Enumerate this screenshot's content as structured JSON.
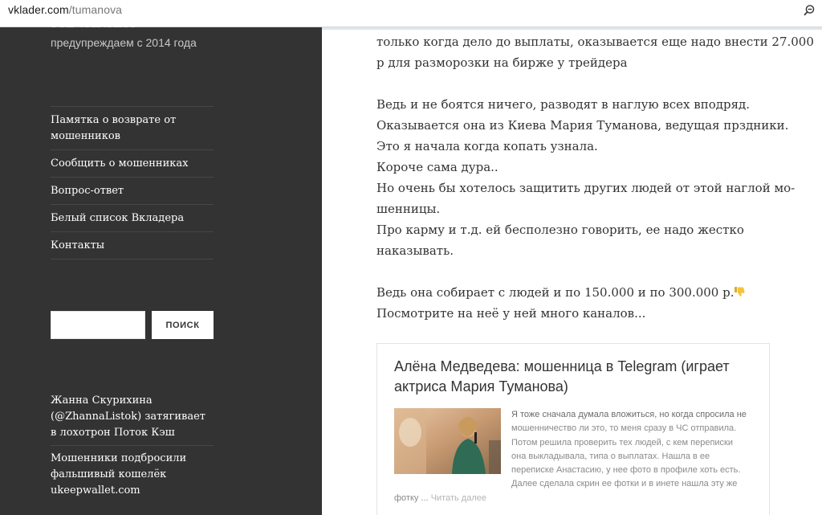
{
  "browser": {
    "domain": "vklader.com",
    "path": "/tumanova",
    "zoom_icon": "zoom-out-icon"
  },
  "sidebar": {
    "site_title": "Вкладер",
    "tagline": "предупреждаем с 2014 года",
    "menu": [
      "Памятка о возврате от мошенников",
      "Сообщить о мошенниках",
      "Вопрос-ответ",
      "Белый список Вкладера",
      "Контакты"
    ],
    "search": {
      "placeholder": "",
      "button_label": "ПОИСК"
    },
    "recent_posts": [
      "Жанна Скурихина (@ZhannaListok) затягивает в лохотрон Поток Кэш",
      "Мошенники подбросили фальшивый кошелёк ukeepwallet.com"
    ]
  },
  "post": {
    "paragraphs": [
      [
        "только когда дело до выплаты, оказывается еще надо внести 27.000",
        "р для разморозки на бирже у трейдера"
      ],
      [
        "Ведь и не боятся ничего, разводят в наглую всех вподряд.",
        "Оказывается она из Киева Мария Туманова, ведущая прздники.",
        "Это я начала когда копать узнала.",
        "Короче сама дура..",
        "Но очень бы хотелось защитить других людей от этой наглой мо-",
        "шенницы.",
        "Про карму и т.д. ей бесполезно говорить, ее надо жестко",
        "наказывать."
      ],
      [
        "Ведь она собирает с людей и по 150.000 и по 300.000 р.",
        "Посмотрите на неё у ней много каналов..."
      ]
    ],
    "emoji": "thumbs-down-emoji"
  },
  "card": {
    "title": "Алёна Медведева: мошенница в Telegram (играет актриса Мария Туманова)",
    "excerpt_lines": [
      "Я тоже сначала думала вложиться, но когда спросила не",
      "мошенничество ли это, то меня сразу в ЧС отправила.",
      "Потом решила проверить тех людей, с кем переписки",
      "она выкладывала, типа о выплатах. Нашла в ее",
      "переписке Анастасию, у нее фото в профиле хоть есть.",
      "Далее сделала скрин ее фотки и в инете нашла эту же",
      "фотку ..."
    ],
    "read_more": "Читать далее"
  },
  "colors": {
    "sidebar_bg": "#333333",
    "content_bg": "#ffffff",
    "text": "#333333",
    "excerpt_text": "#8a8a8a"
  }
}
